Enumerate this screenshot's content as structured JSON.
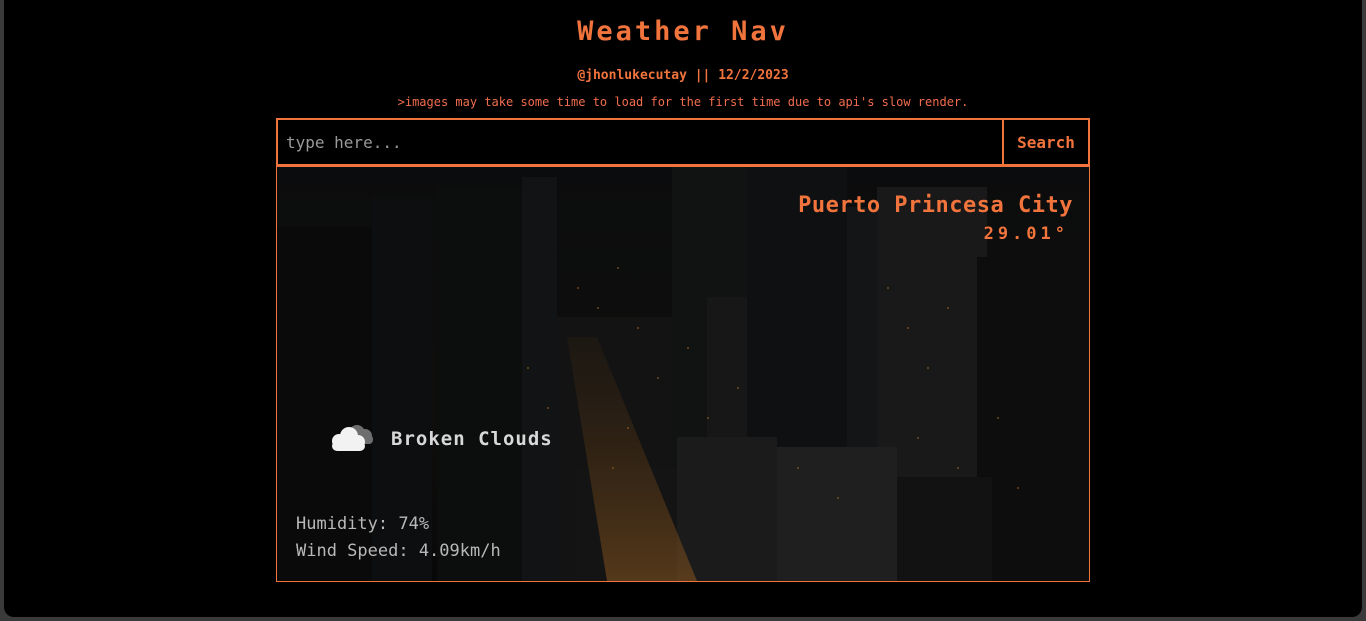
{
  "header": {
    "title": "Weather Nav",
    "credit": "@jhonlukecutay || 12/2/2023",
    "notice": ">images may take some time to load for the first time due to api's slow render."
  },
  "search": {
    "placeholder": "type here...",
    "value": "",
    "button_label": "Search"
  },
  "weather": {
    "city": "Puerto Princesa City",
    "temperature": "29.01°",
    "condition_icon": "broken-clouds-icon",
    "condition": "Broken Clouds",
    "humidity": "Humidity: 74%",
    "wind_speed": "Wind Speed: 4.09km/h"
  },
  "colors": {
    "accent": "#f2743d",
    "background": "#000000",
    "muted_text": "#b8b8b8"
  }
}
